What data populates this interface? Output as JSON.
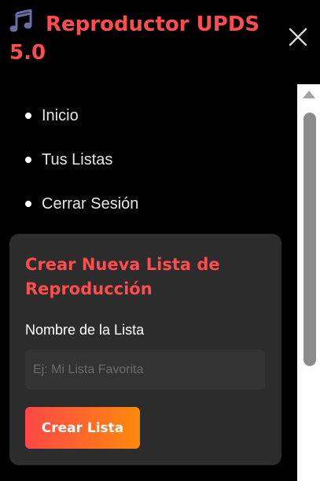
{
  "brand": {
    "icon": "music-icon",
    "title": "Reproductor UPDS 5.0",
    "color": "#ff4c4c"
  },
  "close": {
    "icon": "close-icon"
  },
  "nav": {
    "items": [
      {
        "label": "Inicio"
      },
      {
        "label": "Tus Listas"
      },
      {
        "label": "Cerrar Sesión"
      }
    ]
  },
  "create_form": {
    "title": "Crear Nueva Lista de Reproducción",
    "field_label": "Nombre de la Lista",
    "input_value": "",
    "input_placeholder": "Ej: Mi Lista Favorita",
    "button_label": "Crear Lista",
    "button_gradient": [
      "#ff4747",
      "#ff8a0c"
    ]
  },
  "colors": {
    "background": "#000000",
    "card": "#2c2c2c",
    "accent": "#ff4c4c"
  }
}
